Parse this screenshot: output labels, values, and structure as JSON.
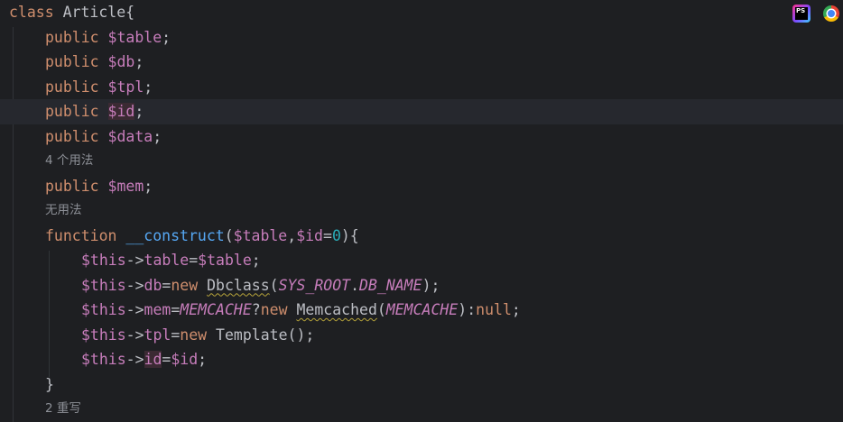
{
  "code": {
    "class_kw": "class",
    "class_name": "Article{",
    "fields": [
      {
        "kw": "public",
        "var": "$table",
        "end": ";"
      },
      {
        "kw": "public",
        "var": "$db",
        "end": ";"
      },
      {
        "kw": "public",
        "var": "$tpl",
        "end": ";"
      },
      {
        "kw": "public",
        "var": "$id",
        "end": ";"
      },
      {
        "kw": "public",
        "var": "$data",
        "end": ";"
      }
    ],
    "hint_usages_4": "4 个用法",
    "mem_field": {
      "kw": "public",
      "var": "$mem",
      "end": ";"
    },
    "hint_no_usages": "无用法",
    "ctor": {
      "kw": "function",
      "name": "__construct",
      "open": "(",
      "p1": "$table",
      "comma": ",",
      "p2": "$id",
      "eq": "=",
      "default": "0",
      "close": "){"
    },
    "body": [
      {
        "this": "$this",
        "arrow": "->",
        "prop": "table",
        "eq": "=",
        "rhs": "$table",
        "end": ";"
      },
      {
        "this": "$this",
        "arrow": "->",
        "prop": "db",
        "eq": "=",
        "new_kw": "new",
        "cls": "Dbclass",
        "open": "(",
        "c1": "SYS_ROOT",
        "dot": ".",
        "c2": "DB_NAME",
        "end": ");"
      },
      {
        "this": "$this",
        "arrow": "->",
        "prop": "mem",
        "eq": "=",
        "c1": "MEMCACHE",
        "q": "?",
        "new_kw": "new",
        "cls": "Memcached",
        "open": "(",
        "c2": "MEMCACHE",
        "colon": "):",
        "null_kw": "null",
        "end": ";"
      },
      {
        "this": "$this",
        "arrow": "->",
        "prop": "tpl",
        "eq": "=",
        "new_kw": "new",
        "cls": "Template",
        "end": "();"
      },
      {
        "this": "$this",
        "arrow": "->",
        "prop": "id",
        "eq": "=",
        "rhs": "$id",
        "end": ";"
      }
    ],
    "ctor_close": "}",
    "hint_overrides_2": "2 重写"
  },
  "toolbar": {
    "phpstorm_icon_label": "PS",
    "icons": [
      "phpstorm-icon",
      "chrome-icon"
    ]
  },
  "colors": {
    "background": "#1e1f22",
    "current_line": "#26282e",
    "keyword": "#cf8e6d",
    "variable": "#c77dbb",
    "function": "#56a8f5",
    "number": "#2aacb8",
    "text": "#bcbec4",
    "hint": "#8c8f96"
  }
}
